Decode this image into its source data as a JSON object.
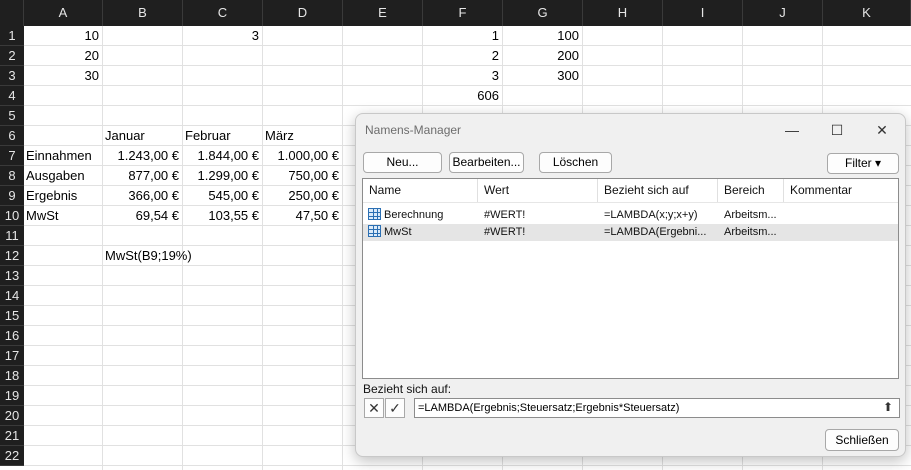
{
  "columns": [
    "A",
    "B",
    "C",
    "D",
    "E",
    "F",
    "G",
    "H",
    "I",
    "J",
    "K"
  ],
  "rows": [
    "1",
    "2",
    "3",
    "4",
    "5",
    "6",
    "7",
    "8",
    "9",
    "10",
    "11",
    "12",
    "13",
    "14",
    "15",
    "16",
    "17",
    "18",
    "19",
    "20",
    "21",
    "22"
  ],
  "cells": {
    "A1": "10",
    "C1": "3",
    "F1": "1",
    "G1": "100",
    "A2": "20",
    "F2": "2",
    "G2": "200",
    "A3": "30",
    "F3": "3",
    "G3": "300",
    "F4": "606",
    "B6": "Januar",
    "C6": "Februar",
    "D6": "März",
    "A7": "Einnahmen",
    "B7": "1.243,00 €",
    "C7": "1.844,00 €",
    "D7": "1.000,00 €",
    "A8": "Ausgaben",
    "B8": "877,00 €",
    "C8": "1.299,00 €",
    "D8": "750,00 €",
    "A9": "Ergebnis",
    "B9": "366,00 €",
    "C9": "545,00 €",
    "D9": "250,00 €",
    "A10": "MwSt",
    "B10": "69,54 €",
    "C10": "103,55 €",
    "D10": "47,50 €",
    "B12": "MwSt(B9;19%)"
  },
  "dialog": {
    "title": "Namens-Manager",
    "minimize": "—",
    "maximize": "☐",
    "close": "✕",
    "buttons": {
      "new": "Neu...",
      "edit": "Bearbeiten...",
      "delete": "Löschen",
      "filter": "Filter ▾"
    },
    "list_headers": [
      "Name",
      "Wert",
      "Bezieht sich auf",
      "Bereich",
      "Kommentar"
    ],
    "list_rows": [
      {
        "name": "Berechnung",
        "value": "#WERT!",
        "refers": "=LAMBDA(x;y;x+y)",
        "scope": "Arbeitsm...",
        "comment": ""
      },
      {
        "name": "MwSt",
        "value": "#WERT!",
        "refers": "=LAMBDA(Ergebni...",
        "scope": "Arbeitsm...",
        "comment": ""
      }
    ],
    "refers_label": "Bezieht sich auf:",
    "refers_value": "=LAMBDA(Ergebnis;Steuersatz;Ergebnis*Steuersatz)",
    "cancel_icon": "✕",
    "confirm_icon": "✓",
    "collapse_icon": "⬆",
    "close_button": "Schließen"
  },
  "colors": {
    "header_bg": "#1f1f1f",
    "selected_row": "#e5e5e5",
    "icon_blue": "#2b6fb3"
  }
}
